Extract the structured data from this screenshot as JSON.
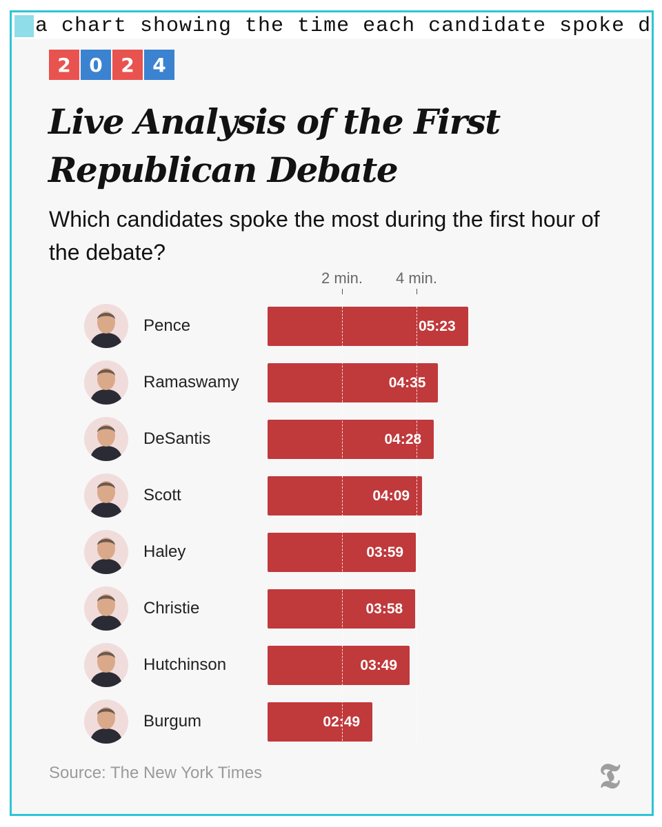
{
  "caption": "a chart showing the time each candidate spoke during the first hour",
  "badge": [
    {
      "text": "2",
      "color": "#e8534f"
    },
    {
      "text": "0",
      "color": "#3b82d1"
    },
    {
      "text": "2",
      "color": "#e8534f"
    },
    {
      "text": "4",
      "color": "#3b82d1"
    }
  ],
  "headline": "Live Analysis of the First Republican Debate",
  "subhead": "Which candidates spoke the most during the first hour of the debate?",
  "source": "Source: The New York Times",
  "logo_icon": "nyt-t-logo",
  "bar_color": "#c0393b",
  "chart_data": {
    "type": "bar",
    "orientation": "horizontal",
    "categories": [
      "Pence",
      "Ramaswamy",
      "DeSantis",
      "Scott",
      "Haley",
      "Christie",
      "Hutchinson",
      "Burgum"
    ],
    "values": [
      5.383,
      4.583,
      4.467,
      4.15,
      3.983,
      3.967,
      3.817,
      2.817
    ],
    "value_labels": [
      "05:23",
      "04:35",
      "04:28",
      "04:09",
      "03:59",
      "03:58",
      "03:49",
      "02:49"
    ],
    "axis_ticks": [
      {
        "value": 2,
        "label": "2 min."
      },
      {
        "value": 4,
        "label": "4 min."
      }
    ],
    "xlim": [
      0,
      6
    ],
    "grid": "dashed at ticks"
  }
}
